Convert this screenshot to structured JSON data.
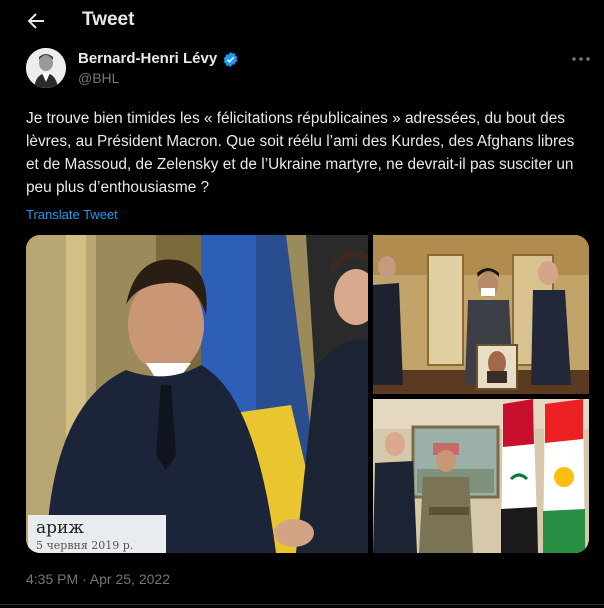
{
  "header": {
    "title": "Tweet",
    "back_icon": "arrow-left-icon"
  },
  "author": {
    "name": "Bernard-Henri Lévy",
    "handle": "@BHL",
    "verified_icon": "verified-badge-icon",
    "verified_color": "#1d9bf0"
  },
  "tweet": {
    "text": "Je trouve bien timides les « félicitations républicaines » adressées, du bout des lèvres,  au Président Macron. Que soit réélu l’ami des Kurdes, des Afghans libres et de Massoud, de Zelensky et de l’Ukraine martyre, ne devrait-il pas susciter un peu plus d’enthousiasme ?",
    "translate_label": "Translate Tweet",
    "timestamp": "4:35 PM · Apr 25, 2022"
  },
  "media": {
    "photo1_sign_line1": "ариж",
    "photo1_sign_line2": "5 червня 2019 р."
  },
  "colors": {
    "background": "#000000",
    "text": "#e7e9ea",
    "muted": "#71767b",
    "link": "#1d9bf0"
  }
}
